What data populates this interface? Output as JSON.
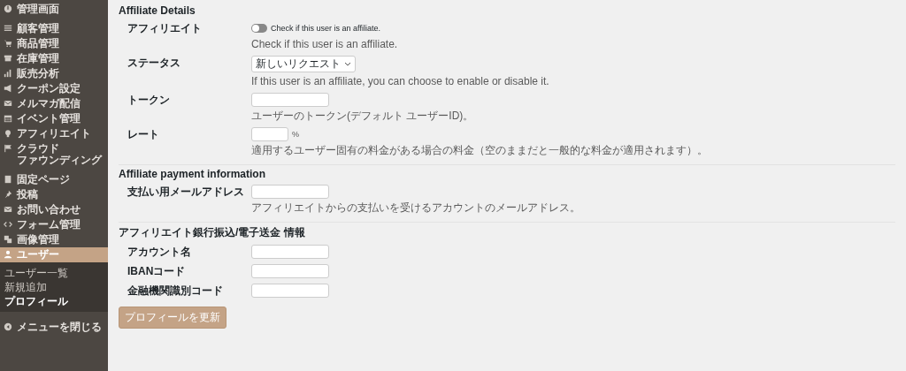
{
  "sidebar": {
    "groups": [
      [
        {
          "label": "管理画面",
          "selected": false
        }
      ],
      [
        {
          "label": "顧客管理",
          "selected": false
        },
        {
          "label": "商品管理",
          "selected": false
        },
        {
          "label": "在庫管理",
          "selected": false
        },
        {
          "label": "販売分析",
          "selected": false
        },
        {
          "label": "クーポン設定",
          "selected": false
        },
        {
          "label": "メルマガ配信",
          "selected": false
        },
        {
          "label": "イベント管理",
          "selected": false
        },
        {
          "label": "アフィリエイト",
          "selected": false
        },
        {
          "label_lines": [
            "クラウド",
            "ファウンディング"
          ],
          "selected": false
        }
      ],
      [
        {
          "label": "固定ページ",
          "selected": false
        },
        {
          "label": "投稿",
          "selected": false
        },
        {
          "label": "お問い合わせ",
          "selected": false
        },
        {
          "label": "フォーム管理",
          "selected": false
        },
        {
          "label": "画像管理",
          "selected": false
        },
        {
          "label": "ユーザー",
          "selected": true,
          "children": [
            {
              "label": "ユーザー一覧",
              "selected": false
            },
            {
              "label": "新規追加",
              "selected": false
            },
            {
              "label": "プロフィール",
              "selected": true
            }
          ]
        }
      ]
    ],
    "collapse_label": "メニューを閉じる"
  },
  "sections": [
    {
      "title": "Affiliate Details",
      "fields": [
        {
          "kind": "toggle",
          "label": "アフィリエイト",
          "on": false,
          "toggle_label": "Check if this user is an affiliate.",
          "description": "Check if this user is an affiliate."
        },
        {
          "kind": "select",
          "label": "ステータス",
          "value": "新しいリクエスト",
          "description": "If this user is an affiliate, you can choose to enable or disable it."
        },
        {
          "kind": "text",
          "label": "トークン",
          "description": "ユーザーのトークン(デフォルト ユーザーID)。"
        },
        {
          "kind": "short_text",
          "label": "レート",
          "suffix": "%",
          "description": "適用するユーザー固有の料金がある場合の料金（空のままだと一般的な料金が適用されます）。"
        }
      ]
    },
    {
      "title": "Affiliate payment information",
      "fields": [
        {
          "kind": "text",
          "label": "支払い用メールアドレス",
          "description": "アフィリエイトからの支払いを受けるアカウントのメールアドレス。"
        }
      ]
    },
    {
      "title": "アフィリエイト銀行振込/電子送金 情報",
      "fields": [
        {
          "kind": "text",
          "label": "アカウント名"
        },
        {
          "kind": "text",
          "label": "IBANコード"
        },
        {
          "kind": "text",
          "label": "金融機関識別コード"
        }
      ]
    }
  ],
  "submit_button": "プロフィールを更新"
}
